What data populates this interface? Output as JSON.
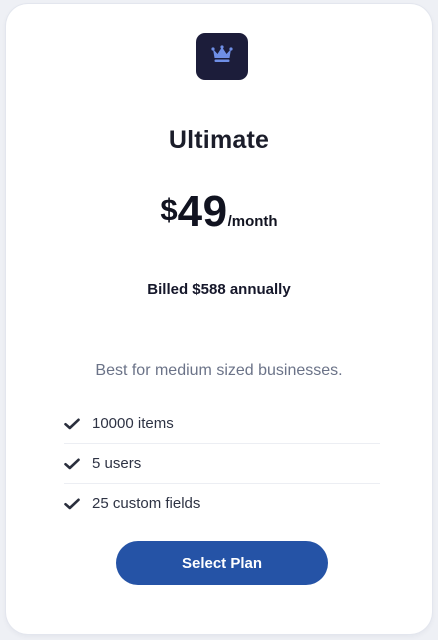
{
  "plan": {
    "icon": "crown-icon",
    "name": "Ultimate",
    "price": {
      "currency": "$",
      "amount": "49",
      "period": "/month"
    },
    "billing": "Billed $588 annually",
    "description": "Best for medium sized businesses.",
    "features": [
      {
        "icon": "check-icon",
        "label": "10000 items"
      },
      {
        "icon": "check-icon",
        "label": "5 users"
      },
      {
        "icon": "check-icon",
        "label": "25 custom fields"
      }
    ],
    "cta_label": "Select Plan"
  },
  "colors": {
    "badge_bg": "#1c1d3a",
    "crown": "#6f8fe6",
    "button_bg": "#2553a6",
    "card_bg": "#ffffff"
  }
}
